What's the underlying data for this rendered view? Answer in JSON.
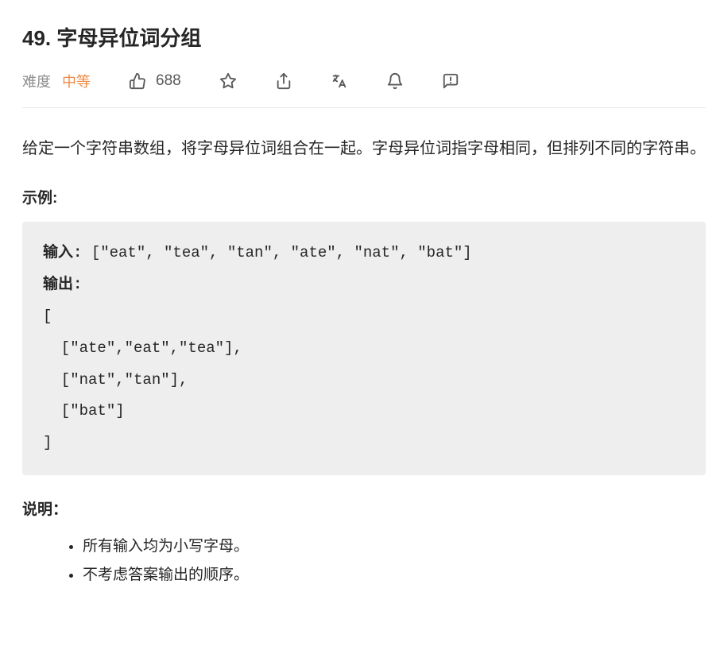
{
  "title": "49. 字母异位词分组",
  "meta": {
    "difficulty_label": "难度",
    "difficulty_value": "中等",
    "likes_count": "688"
  },
  "description": "给定一个字符串数组，将字母异位词组合在一起。字母异位词指字母相同，但排列不同的字符串。",
  "example_label": "示例:",
  "code": {
    "input_label": "输入: ",
    "input_value": "[\"eat\", \"tea\", \"tan\", \"ate\", \"nat\", \"bat\"]",
    "output_label": "输出:",
    "output_value": "[\n  [\"ate\",\"eat\",\"tea\"],\n  [\"nat\",\"tan\"],\n  [\"bat\"]\n]"
  },
  "notes_label": "说明：",
  "notes": [
    "所有输入均为小写字母。",
    "不考虑答案输出的顺序。"
  ]
}
